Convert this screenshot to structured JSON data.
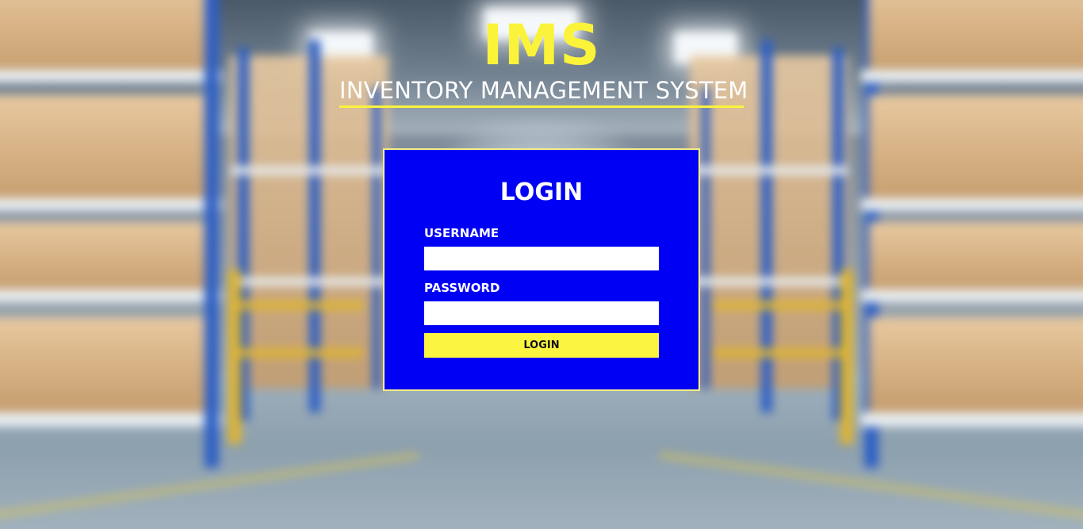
{
  "header": {
    "brand": "IMS",
    "subtitle": "INVENTORY MANAGEMENT SYSTEM"
  },
  "login": {
    "title": "LOGIN",
    "username_label": "USERNAME",
    "username_value": "",
    "password_label": "PASSWORD",
    "password_value": "",
    "submit_label": "LOGIN"
  },
  "colors": {
    "accent_yellow": "#fbf33a",
    "panel_blue": "#0000f5",
    "panel_border": "#f2ef86",
    "button_yellow": "#fbf542"
  },
  "background": {
    "description_icon": "warehouse-aisle-image"
  }
}
